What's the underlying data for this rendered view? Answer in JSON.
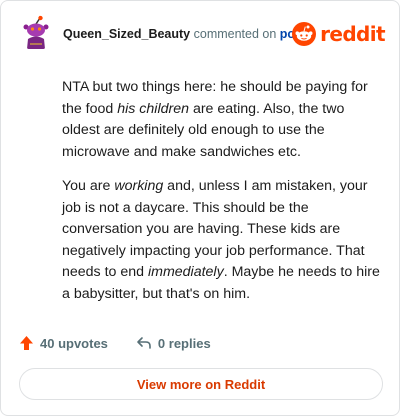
{
  "header": {
    "username": "Queen_Sized_Beauty",
    "commented_text": "commented on",
    "post_link": "post",
    "brand_name": "reddit",
    "avatar_icon": "snoo-avatar-icon",
    "brand_icon": "reddit-snoo-logo-icon"
  },
  "comment": {
    "p1_a": "NTA but two things here: he should be paying for the food ",
    "p1_em": "his children",
    "p1_b": " are eating. Also, the two oldest are definitely old enough to use the microwave and make sandwiches etc.",
    "p2_a": "You are ",
    "p2_em1": "working",
    "p2_b": " and, unless I am mistaken, your job is not a daycare. This should be the conversation you are having. These kids are negatively impacting your job performance. That needs to end ",
    "p2_em2": "immediately",
    "p2_c": ". Maybe he needs to hire a babysitter, but that's on him."
  },
  "actions": {
    "upvotes": "40 upvotes",
    "replies": "0 replies",
    "upvote_icon": "upvote-arrow-icon",
    "reply_icon": "reply-arrow-icon"
  },
  "footer": {
    "view_more": "View more on Reddit"
  },
  "colors": {
    "brand": "#ff4500",
    "link": "#0045ac",
    "button_text": "#d93a00",
    "muted": "#576f76"
  }
}
